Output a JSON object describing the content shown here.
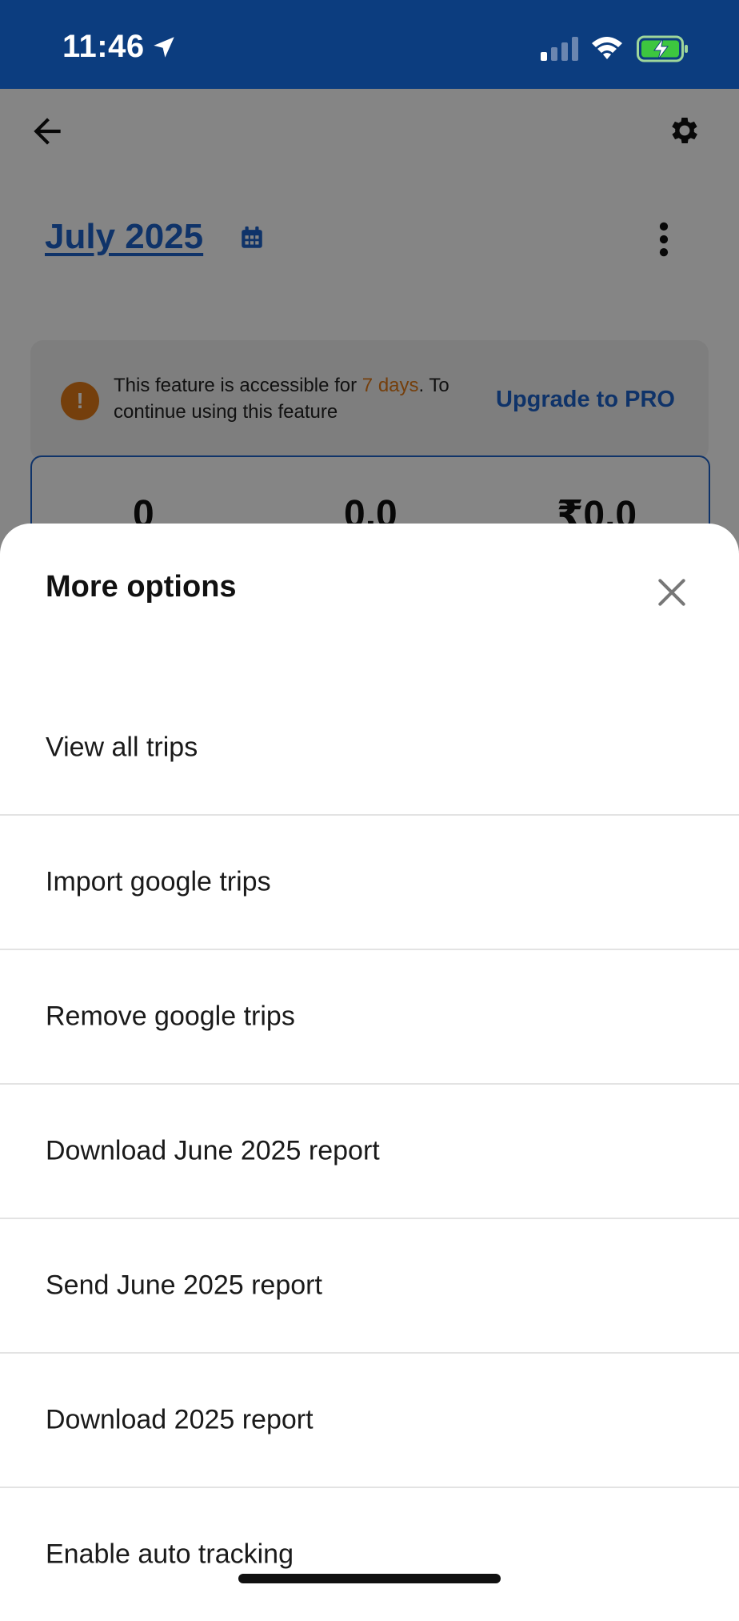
{
  "status_bar": {
    "time": "11:46"
  },
  "header": {
    "month_title": "July 2025"
  },
  "notice": {
    "icon_glyph": "!",
    "text_before": "This feature is accessible for ",
    "days": "7 days",
    "text_after": ". To continue using this feature",
    "upgrade_label": "Upgrade to PRO"
  },
  "stats": {
    "trips": "0",
    "distance": "0.0",
    "amount": "₹0.0"
  },
  "sheet": {
    "title": "More options",
    "options": [
      {
        "label": "View all trips"
      },
      {
        "label": "Import google trips"
      },
      {
        "label": "Remove google trips"
      },
      {
        "label": "Download June 2025 report"
      },
      {
        "label": "Send June 2025 report"
      },
      {
        "label": "Download 2025 report"
      },
      {
        "label": "Enable auto tracking"
      }
    ]
  },
  "colors": {
    "status_bar_bg": "#0c3d7f",
    "accent_blue": "#1e63c9",
    "warning_orange": "#e07a17"
  }
}
